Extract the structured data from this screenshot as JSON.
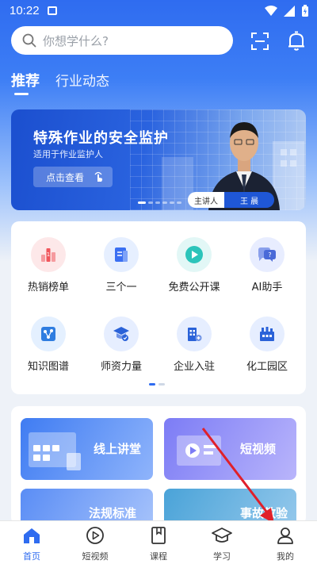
{
  "status_bar": {
    "time": "10:22"
  },
  "search": {
    "placeholder": "你想学什么?"
  },
  "tabs": [
    {
      "label": "推荐",
      "active": true
    },
    {
      "label": "行业动态",
      "active": false
    }
  ],
  "banner": {
    "title": "特殊作业的安全监护",
    "subtitle": "适用于作业监护人",
    "cta": "点击查看",
    "lecturer_label": "主讲人",
    "lecturer_name": "王 晨"
  },
  "quick_grid": [
    {
      "label": "热销榜单",
      "icon": "hot-list-icon",
      "color": "#f0565c",
      "bg": "#fde8e9"
    },
    {
      "label": "三个一",
      "icon": "document-icon",
      "color": "#3a6ff2",
      "bg": "#e6efff"
    },
    {
      "label": "免费公开课",
      "icon": "play-icon",
      "color": "#19b9b0",
      "bg": "#e2f7f6"
    },
    {
      "label": "AI助手",
      "icon": "ai-chat-icon",
      "color": "#4a6ad8",
      "bg": "#e8edff"
    },
    {
      "label": "知识图谱",
      "icon": "graph-icon",
      "color": "#2f7de0",
      "bg": "#e4f0ff"
    },
    {
      "label": "师资力量",
      "icon": "teacher-icon",
      "color": "#2a62d8",
      "bg": "#e6eeff"
    },
    {
      "label": "企业入驻",
      "icon": "enterprise-icon",
      "color": "#2a62d8",
      "bg": "#e6eeff"
    },
    {
      "label": "化工园区",
      "icon": "factory-icon",
      "color": "#2a62d8",
      "bg": "#e6eeff"
    }
  ],
  "features": [
    {
      "label": "线上讲堂"
    },
    {
      "label": "短视频"
    },
    {
      "label": "法规标准"
    },
    {
      "label": "事故教验"
    }
  ],
  "bottom_nav": [
    {
      "label": "首页",
      "icon": "home-icon",
      "active": true
    },
    {
      "label": "短视频",
      "icon": "video-icon",
      "active": false
    },
    {
      "label": "课程",
      "icon": "course-icon",
      "active": false
    },
    {
      "label": "学习",
      "icon": "study-icon",
      "active": false
    },
    {
      "label": "我的",
      "icon": "profile-icon",
      "active": false
    }
  ],
  "colors": {
    "primary": "#2f6cf0",
    "arrow": "#e0202a"
  }
}
